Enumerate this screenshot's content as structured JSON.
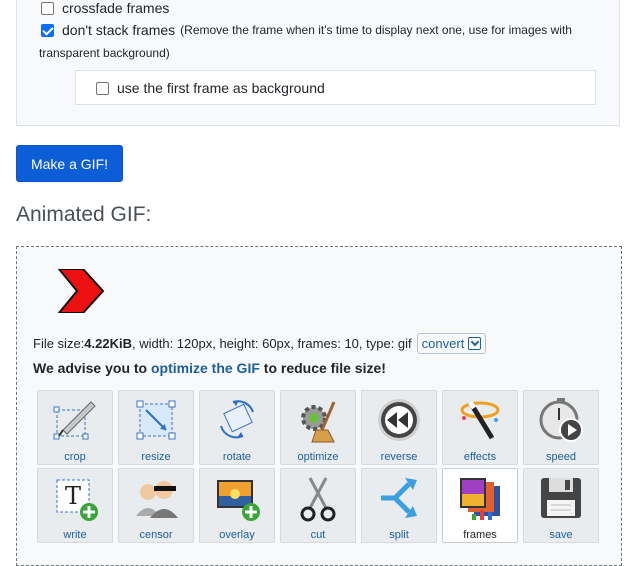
{
  "options": {
    "crossfade_label": "crossfade frames",
    "crossfade_checked": false,
    "dont_stack_label": "don't stack frames",
    "dont_stack_checked": true,
    "dont_stack_note_line1": "(Remove the frame when it's time to display next one, use for images with",
    "dont_stack_note_line2": "transparent background)",
    "first_frame_label": "use the first frame as background",
    "first_frame_checked": false
  },
  "make_button_label": "Make a GIF!",
  "section_title": "Animated GIF:",
  "fileinfo": {
    "prefix": "File size: ",
    "size": "4.22KiB",
    "details": ", width: 120px, height: 60px, frames: 10, type: gif",
    "convert_label": "convert"
  },
  "advise": {
    "before": "We advise you to ",
    "link": "optimize the GIF",
    "after": " to reduce file size!"
  },
  "tools_row1": [
    {
      "label": "crop",
      "icon": "crop-icon"
    },
    {
      "label": "resize",
      "icon": "resize-icon"
    },
    {
      "label": "rotate",
      "icon": "rotate-icon"
    },
    {
      "label": "optimize",
      "icon": "optimize-icon"
    },
    {
      "label": "reverse",
      "icon": "reverse-icon"
    },
    {
      "label": "effects",
      "icon": "effects-icon"
    },
    {
      "label": "speed",
      "icon": "speed-icon"
    }
  ],
  "tools_row2": [
    {
      "label": "write",
      "icon": "write-icon"
    },
    {
      "label": "censor",
      "icon": "censor-icon"
    },
    {
      "label": "overlay",
      "icon": "overlay-icon"
    },
    {
      "label": "cut",
      "icon": "cut-icon"
    },
    {
      "label": "split",
      "icon": "split-icon"
    },
    {
      "label": "frames",
      "icon": "frames-icon"
    },
    {
      "label": "save",
      "icon": "save-icon"
    }
  ],
  "active_tool": "frames",
  "colors": {
    "primary": "#0b5ed7",
    "link": "#1d5f9c",
    "gif_arrow": "#ee1111"
  }
}
